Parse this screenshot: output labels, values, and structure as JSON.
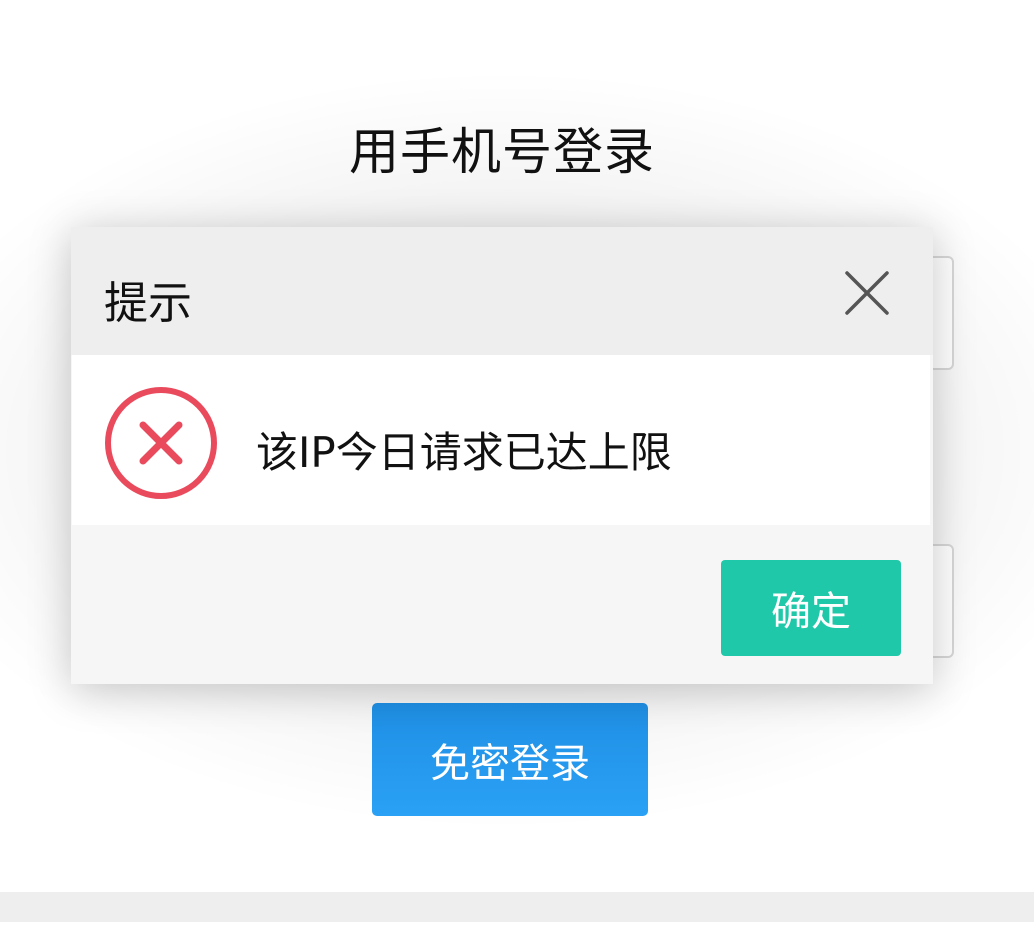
{
  "login": {
    "title": "用手机号登录",
    "button_label": "免密登录"
  },
  "dialog": {
    "title": "提示",
    "message": "该IP今日请求已达上限",
    "confirm_label": "确定",
    "icons": {
      "close": "close-icon",
      "error": "error-circle-icon"
    }
  },
  "colors": {
    "error_red": "#e94b5d",
    "confirm_green": "#1fc8a8",
    "login_blue": "#2196f3"
  }
}
